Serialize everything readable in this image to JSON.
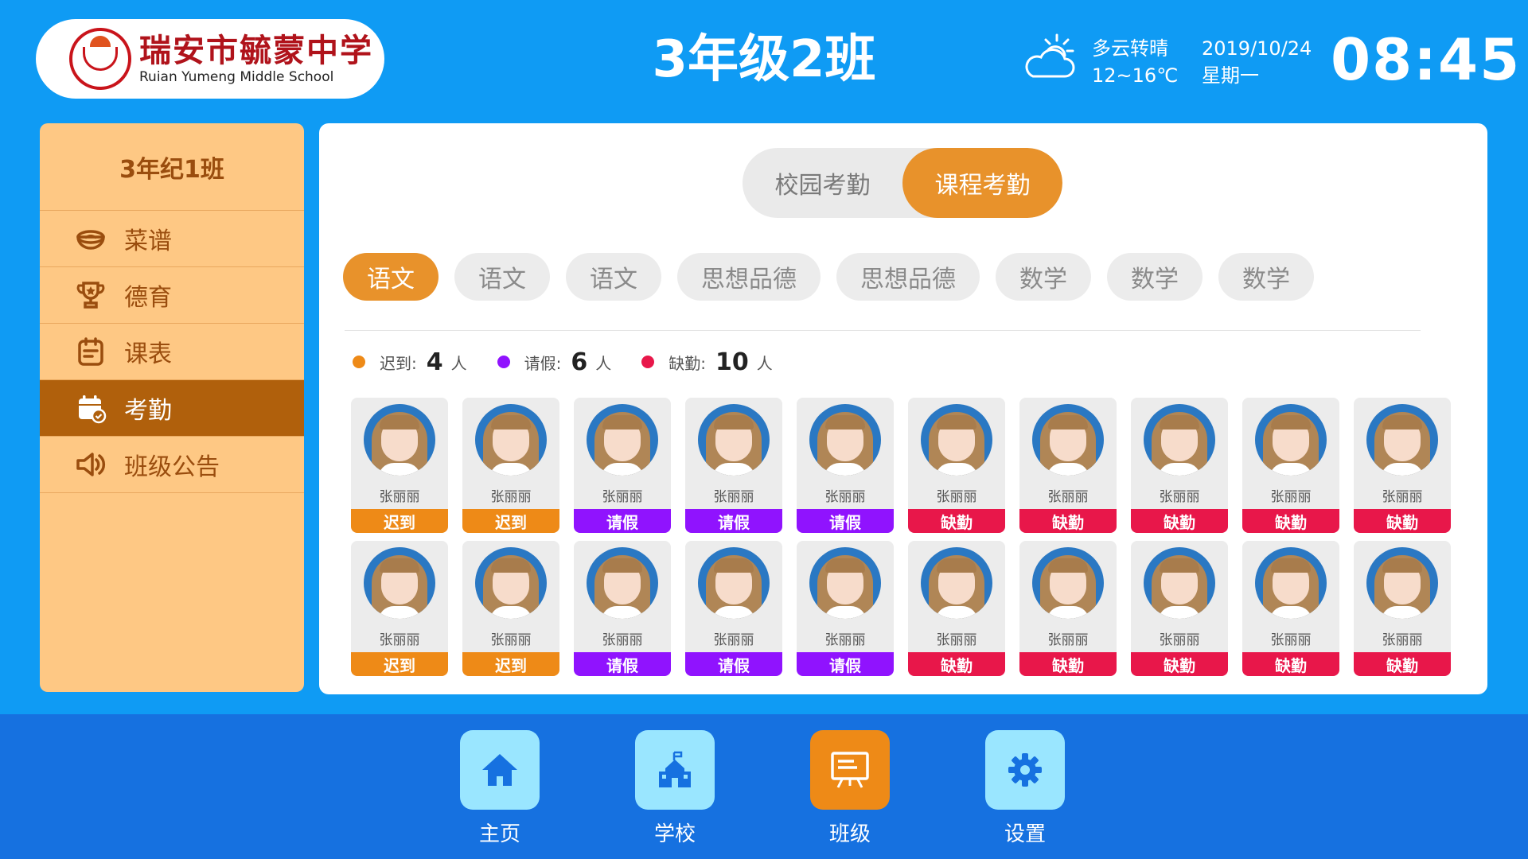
{
  "header": {
    "school_name_cn": "瑞安市毓蒙中学",
    "school_name_en": "Ruian Yumeng Middle School",
    "class_title": "3年级2班",
    "weather": {
      "condition": "多云转晴",
      "temp_range": "12~16℃"
    },
    "date": "2019/10/24",
    "weekday": "星期一",
    "time": "08:45"
  },
  "sidebar": {
    "class_name": "3年纪1班",
    "items": [
      {
        "label": "菜谱",
        "icon": "bowl-icon"
      },
      {
        "label": "德育",
        "icon": "trophy-icon"
      },
      {
        "label": "课表",
        "icon": "schedule-icon"
      },
      {
        "label": "考勤",
        "icon": "attendance-calendar-icon",
        "active": true
      },
      {
        "label": "班级公告",
        "icon": "speaker-icon"
      }
    ]
  },
  "attendance": {
    "tabs": [
      {
        "label": "校园考勤",
        "active": false
      },
      {
        "label": "课程考勤",
        "active": true
      }
    ],
    "subjects": [
      {
        "label": "语文",
        "active": true
      },
      {
        "label": "语文",
        "active": false
      },
      {
        "label": "语文",
        "active": false
      },
      {
        "label": "思想品德",
        "active": false
      },
      {
        "label": "思想品德",
        "active": false
      },
      {
        "label": "数学",
        "active": false
      },
      {
        "label": "数学",
        "active": false
      },
      {
        "label": "数学",
        "active": false
      }
    ],
    "stats": [
      {
        "label": "迟到:",
        "count": "4",
        "unit": "人",
        "color": "#ee8a17"
      },
      {
        "label": "请假:",
        "count": "6",
        "unit": "人",
        "color": "#9013fe"
      },
      {
        "label": "缺勤:",
        "count": "10",
        "unit": "人",
        "color": "#e8174a"
      }
    ],
    "status_colors": {
      "迟到": "#ee8a17",
      "请假": "#9013fe",
      "缺勤": "#e8174a"
    },
    "students": [
      {
        "name": "张丽丽",
        "status": "迟到"
      },
      {
        "name": "张丽丽",
        "status": "迟到"
      },
      {
        "name": "张丽丽",
        "status": "请假"
      },
      {
        "name": "张丽丽",
        "status": "请假"
      },
      {
        "name": "张丽丽",
        "status": "请假"
      },
      {
        "name": "张丽丽",
        "status": "缺勤"
      },
      {
        "name": "张丽丽",
        "status": "缺勤"
      },
      {
        "name": "张丽丽",
        "status": "缺勤"
      },
      {
        "name": "张丽丽",
        "status": "缺勤"
      },
      {
        "name": "张丽丽",
        "status": "缺勤"
      },
      {
        "name": "张丽丽",
        "status": "迟到"
      },
      {
        "name": "张丽丽",
        "status": "迟到"
      },
      {
        "name": "张丽丽",
        "status": "请假"
      },
      {
        "name": "张丽丽",
        "status": "请假"
      },
      {
        "name": "张丽丽",
        "status": "请假"
      },
      {
        "name": "张丽丽",
        "status": "缺勤"
      },
      {
        "name": "张丽丽",
        "status": "缺勤"
      },
      {
        "name": "张丽丽",
        "status": "缺勤"
      },
      {
        "name": "张丽丽",
        "status": "缺勤"
      },
      {
        "name": "张丽丽",
        "status": "缺勤"
      }
    ]
  },
  "bottom_nav": {
    "items": [
      {
        "label": "主页",
        "icon": "home-icon",
        "active": false
      },
      {
        "label": "学校",
        "icon": "school-building-icon",
        "active": false
      },
      {
        "label": "班级",
        "icon": "class-board-icon",
        "active": true
      },
      {
        "label": "设置",
        "icon": "settings-gear-icon",
        "active": false
      }
    ]
  }
}
